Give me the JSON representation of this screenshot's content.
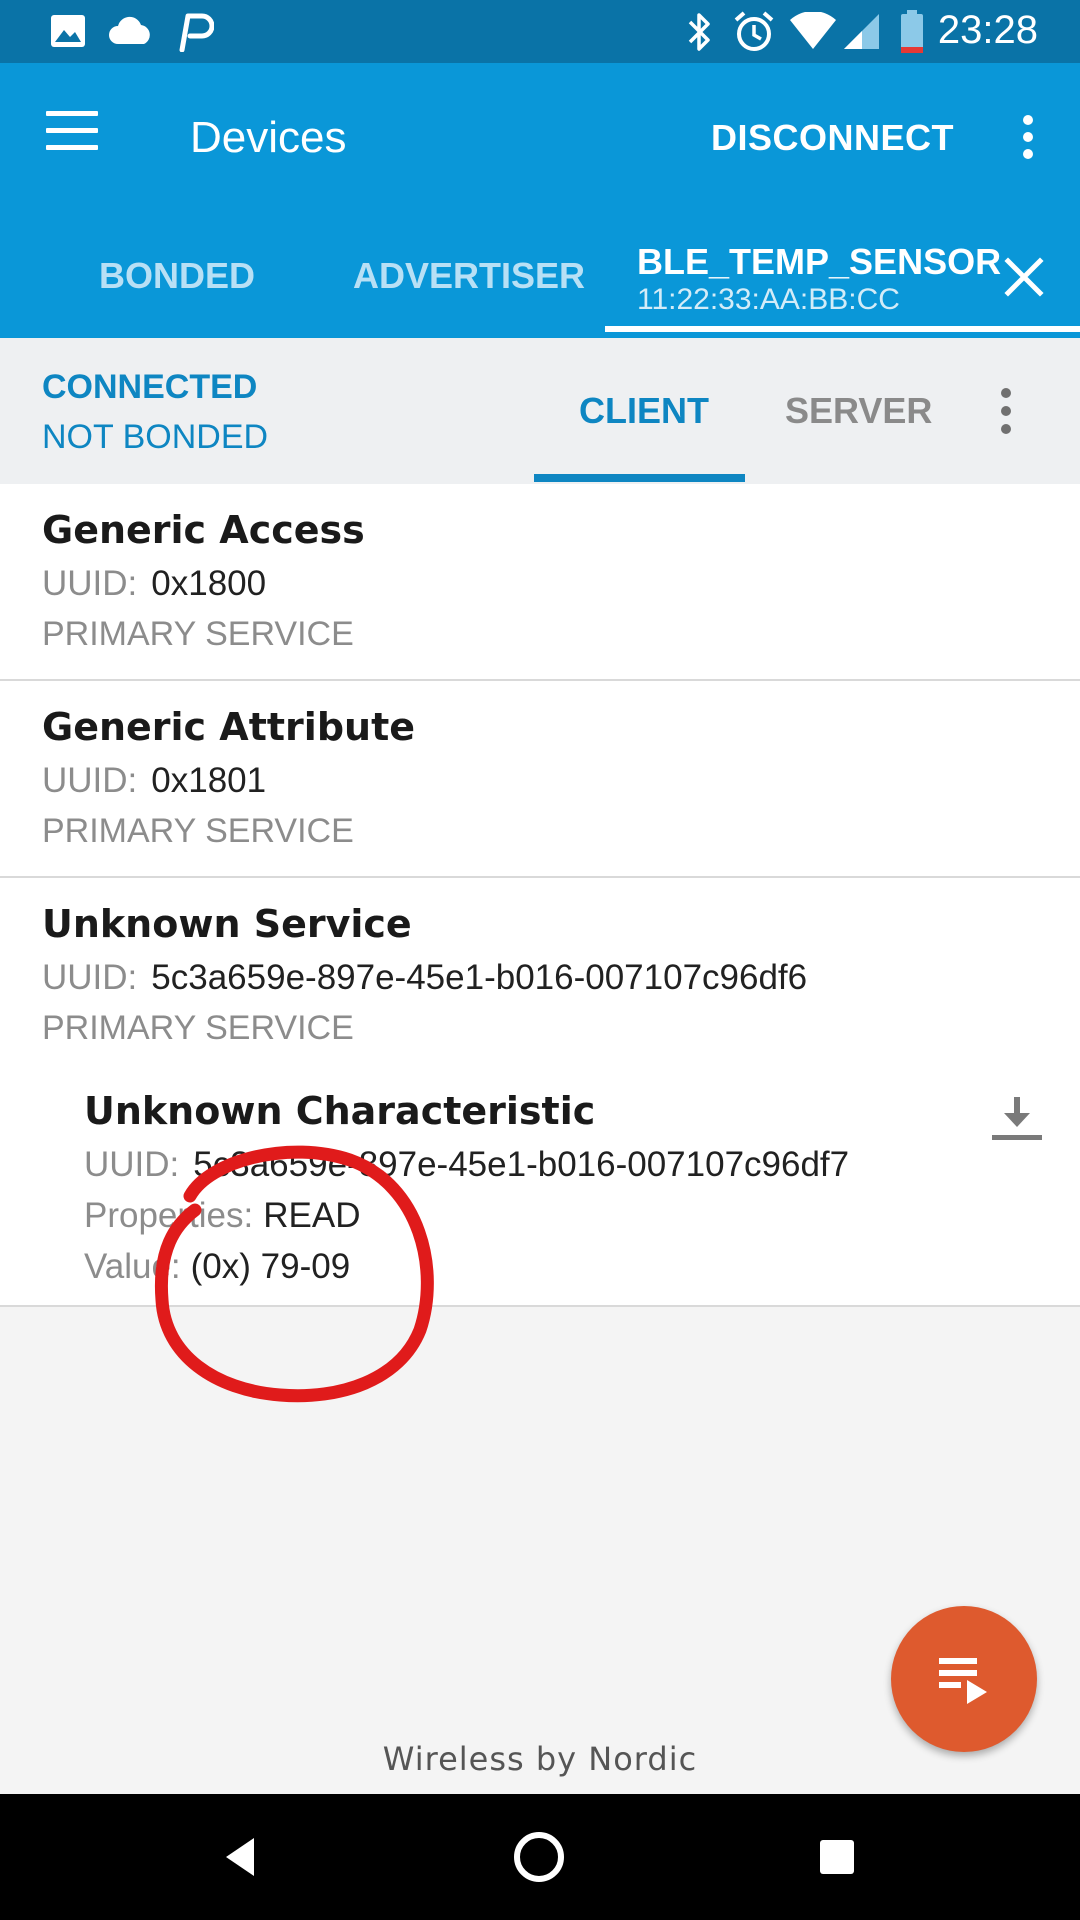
{
  "status_bar": {
    "time": "23:28",
    "left_icons": [
      "image-icon",
      "cloud-icon",
      "pushbullet-icon"
    ],
    "right_icons": [
      "bluetooth-icon",
      "alarm-icon",
      "wifi-icon",
      "cell-signal-icon",
      "battery-icon"
    ]
  },
  "app_bar": {
    "title": "Devices",
    "disconnect_label": "DISCONNECT"
  },
  "device_tabs": [
    {
      "label": "BONDED"
    },
    {
      "label": "ADVERTISER"
    },
    {
      "name": "BLE_TEMP_SENSOR",
      "address": "11:22:33:AA:BB:CC",
      "active": true
    }
  ],
  "connection": {
    "state": "CONNECTED",
    "bond": "NOT BONDED",
    "tabs": [
      {
        "label": "CLIENT",
        "active": true
      },
      {
        "label": "SERVER"
      }
    ]
  },
  "services": [
    {
      "name": "Generic Access",
      "uuid_label": "UUID:",
      "uuid": "0x1800",
      "type": "PRIMARY SERVICE"
    },
    {
      "name": "Generic Attribute",
      "uuid_label": "UUID:",
      "uuid": "0x1801",
      "type": "PRIMARY SERVICE"
    },
    {
      "name": "Unknown Service",
      "uuid_label": "UUID:",
      "uuid": "5c3a659e-897e-45e1-b016-007107c96df6",
      "type": "PRIMARY SERVICE",
      "characteristic": {
        "name": "Unknown Characteristic",
        "uuid_label": "UUID:",
        "uuid": "5c3a659e-897e-45e1-b016-007107c96df7",
        "properties_label": "Properties:",
        "properties": "READ",
        "value_label": "Value:",
        "value": "(0x) 79-09"
      }
    }
  ],
  "footer": {
    "brand": "Wireless by Nordic"
  },
  "colors": {
    "status_bar": "#0a73a7",
    "app_bar": "#0a97d8",
    "accent": "#0e86c2",
    "fab": "#de5a2e",
    "annotation": "#e01b1b"
  }
}
